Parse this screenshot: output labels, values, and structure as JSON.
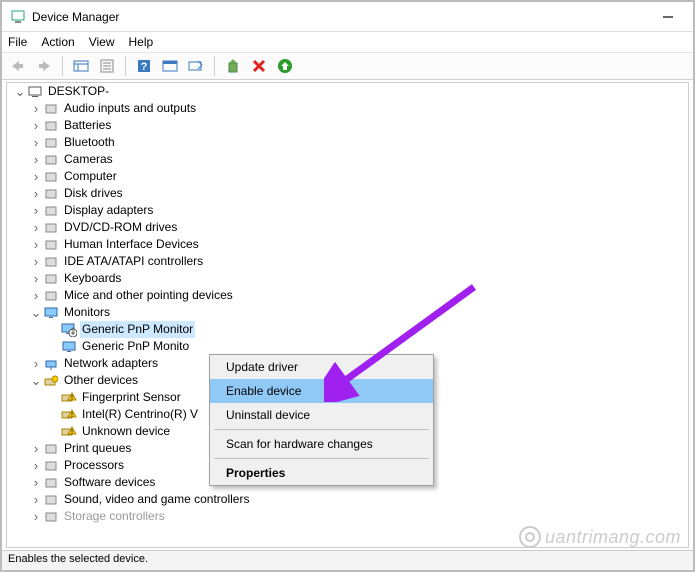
{
  "window": {
    "title": "Device Manager"
  },
  "menu": {
    "file": "File",
    "action": "Action",
    "view": "View",
    "help": "Help"
  },
  "tree": {
    "root": "DESKTOP-",
    "items": [
      "Audio inputs and outputs",
      "Batteries",
      "Bluetooth",
      "Cameras",
      "Computer",
      "Disk drives",
      "Display adapters",
      "DVD/CD-ROM drives",
      "Human Interface Devices",
      "IDE ATA/ATAPI controllers",
      "Keyboards",
      "Mice and other pointing devices"
    ],
    "monitors": {
      "label": "Monitors",
      "child_sel": "Generic PnP Monitor",
      "child2": "Generic PnP Monito"
    },
    "network": "Network adapters",
    "other": {
      "label": "Other devices",
      "children": [
        "Fingerprint Sensor",
        "Intel(R) Centrino(R) V",
        "Unknown device"
      ]
    },
    "rest": [
      "Print queues",
      "Processors",
      "Software devices",
      "Sound, video and game controllers",
      "Storage controllers"
    ]
  },
  "context": {
    "update": "Update driver",
    "enable": "Enable device",
    "uninstall": "Uninstall device",
    "scan": "Scan for hardware changes",
    "properties": "Properties"
  },
  "status": "Enables the selected device.",
  "watermark": "uantrimang.com"
}
